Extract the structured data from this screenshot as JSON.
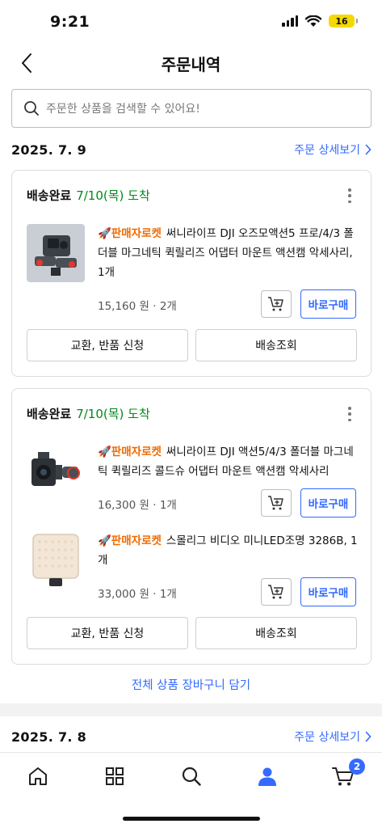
{
  "status_bar": {
    "time": "9:21",
    "battery": "16"
  },
  "header": {
    "title": "주문내역"
  },
  "search": {
    "placeholder": "주문한 상품을 검색할 수 있어요!"
  },
  "orders": [
    {
      "date": "2025. 7. 9",
      "detail_link": "주문 상세보기",
      "shipments": [
        {
          "status": "배송완료",
          "arrival": "7/10(목) 도착",
          "items": [
            {
              "badge": "🚀판매자로켓",
              "name": "써니라이프 DJI 오즈모액션5 프로/4/3 폴더블 마그네틱 퀵릴리즈 어댑터 마운트 액션캠 악세사리, 1개",
              "price": "15,160 원 · 2개",
              "buy_label": "바로구매"
            }
          ],
          "exchange_label": "교환, 반품 신청",
          "tracking_label": "배송조회"
        },
        {
          "status": "배송완료",
          "arrival": "7/10(목) 도착",
          "items": [
            {
              "badge": "🚀판매자로켓",
              "name": "써니라이프 DJI 액션5/4/3 폴더블 마그네틱 퀵릴리즈 콜드슈 어댑터 마운트 액션캠 악세사리",
              "price": "16,300 원 · 1개",
              "buy_label": "바로구매"
            },
            {
              "badge": "🚀판매자로켓",
              "name": "스몰리그 비디오 미니LED조명 3286B, 1개",
              "price": "33,000 원 · 1개",
              "buy_label": "바로구매"
            }
          ],
          "exchange_label": "교환, 반품 신청",
          "tracking_label": "배송조회"
        }
      ],
      "cart_all_label": "전체 상품 장바구니 담기"
    },
    {
      "date": "2025. 7. 8",
      "detail_link": "주문 상세보기"
    }
  ],
  "tab_bar": {
    "icons": [
      "home-icon",
      "category-icon",
      "search-icon",
      "my-page-icon",
      "cart-icon"
    ],
    "cart_count": "2",
    "active_color": "#346aff"
  },
  "colors": {
    "accent": "#346aff",
    "delivered_green": "#00891a",
    "rocket_orange": "#f06a00"
  }
}
